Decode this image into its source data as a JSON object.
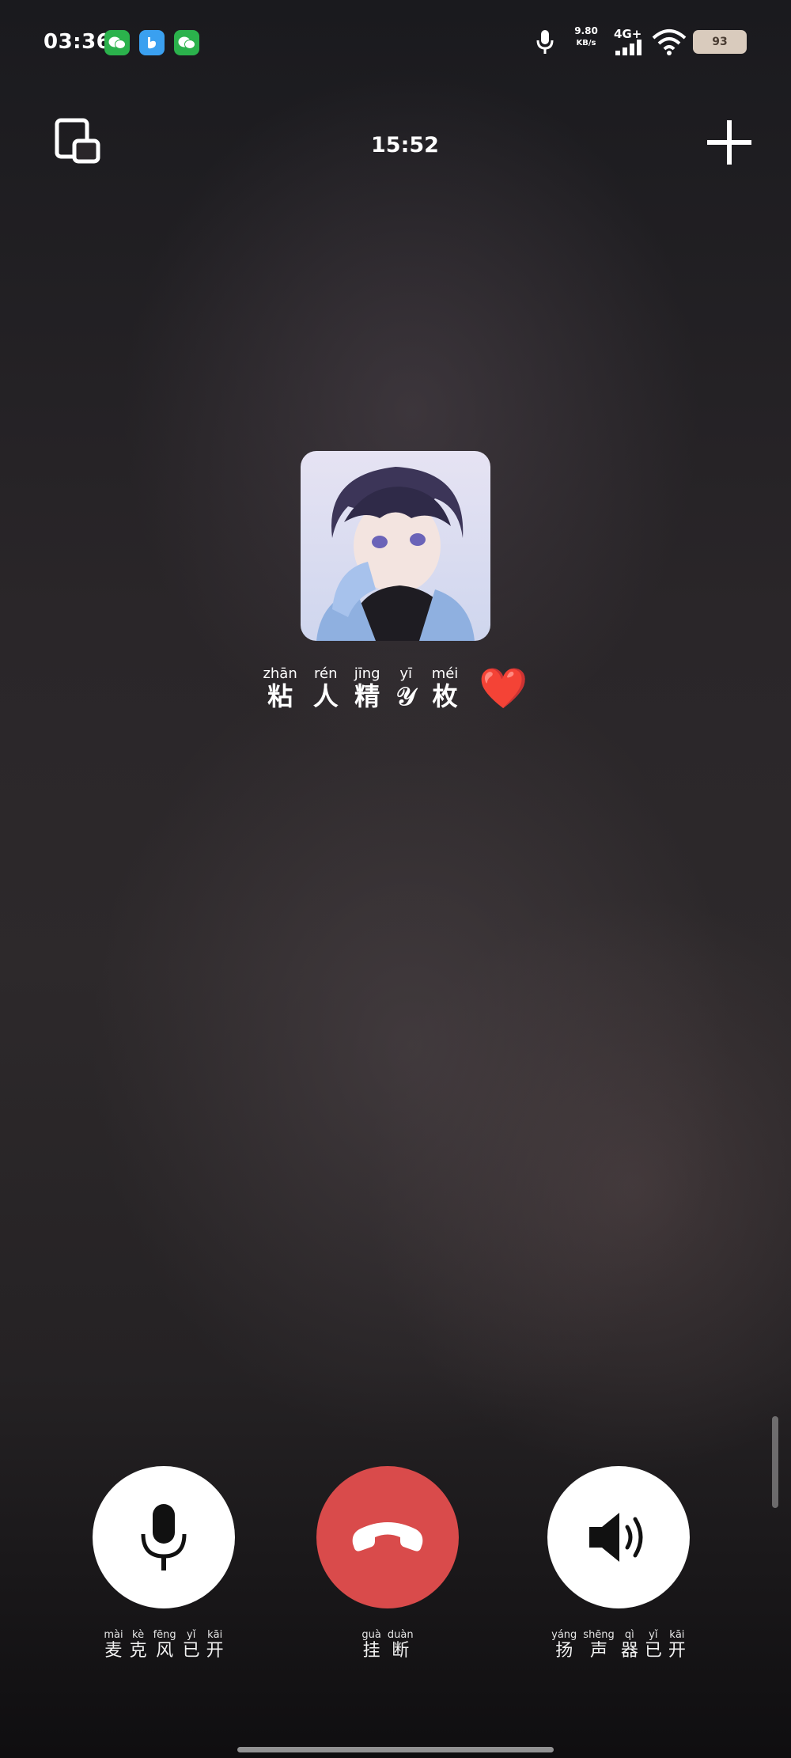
{
  "status_bar": {
    "time": "03:36",
    "net_speed_value": "9.80",
    "net_speed_unit": "KB/s",
    "network": "4G+",
    "battery": "93",
    "apps": [
      "wechat-icon",
      "bluebird-icon",
      "wechat-icon"
    ]
  },
  "header": {
    "call_duration": "15:52"
  },
  "caller": {
    "name_chars": [
      {
        "pinyin": "zhān",
        "char": "粘"
      },
      {
        "pinyin": "rén",
        "char": "人"
      },
      {
        "pinyin": "jīng",
        "char": "精"
      },
      {
        "pinyin": "yī",
        "char": "𝒴"
      },
      {
        "pinyin": "méi",
        "char": "枚"
      }
    ],
    "emoji": "❤️"
  },
  "controls": {
    "mic": {
      "label_chars": [
        {
          "pinyin": "mài",
          "char": "麦"
        },
        {
          "pinyin": "kè",
          "char": "克"
        },
        {
          "pinyin": "fēng",
          "char": "风"
        },
        {
          "pinyin": "yǐ",
          "char": "已"
        },
        {
          "pinyin": "kāi",
          "char": "开"
        }
      ]
    },
    "hangup": {
      "label_chars": [
        {
          "pinyin": "guà",
          "char": "挂"
        },
        {
          "pinyin": "duàn",
          "char": "断"
        }
      ]
    },
    "speaker": {
      "label_chars": [
        {
          "pinyin": "yáng",
          "char": "扬"
        },
        {
          "pinyin": "shēng",
          "char": "声"
        },
        {
          "pinyin": "qì",
          "char": "器"
        },
        {
          "pinyin": "yǐ",
          "char": "已"
        },
        {
          "pinyin": "kāi",
          "char": "开"
        }
      ]
    }
  },
  "colors": {
    "hangup": "#d94b4b",
    "control_bg": "#ffffff",
    "heart": "#e8232b"
  }
}
